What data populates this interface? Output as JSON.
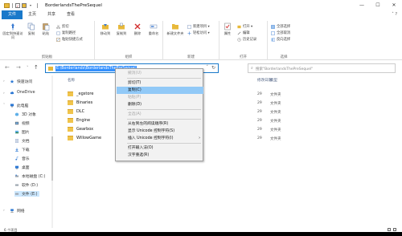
{
  "window": {
    "title": "BorderlandsThePreSequel",
    "controls": [
      "—",
      "☐",
      "✕"
    ]
  },
  "ribbon_tabs": [
    "文件",
    "主页",
    "共享",
    "查看"
  ],
  "ribbon": {
    "clipboard": {
      "label": "剪贴板",
      "pin": "固定到快速访问",
      "copy": "复制",
      "paste": "粘贴",
      "cut": "剪切",
      "copy_path": "复制路径",
      "paste_shortcut": "粘贴快捷方式"
    },
    "organize": {
      "label": "组织",
      "move_to": "移动到",
      "copy_to": "复制到",
      "delete": "删除",
      "rename": "重命名"
    },
    "new": {
      "label": "新建",
      "new_folder": "新建文件夹",
      "new_item": "新建项目 ▾",
      "easy_access": "轻松访问 ▾"
    },
    "open": {
      "label": "打开",
      "properties": "属性",
      "open": "打开 ▾",
      "edit": "编辑",
      "history": "历史记录"
    },
    "select": {
      "label": "选择",
      "select_all": "全部选择",
      "select_none": "全部取消",
      "invert": "反向选择"
    }
  },
  "address": {
    "path": "E:\\Borderlands\\BorderlandsThePreSequel",
    "search_placeholder": "搜索\"BorderlandsThePreSequel\""
  },
  "columns": {
    "name": "名称",
    "date": "修改日期",
    "type": "类型"
  },
  "nav_pane": [
    {
      "label": "快速访问",
      "icon": "star-icon"
    },
    {
      "label": "OneDrive",
      "icon": "cloud-icon"
    },
    {
      "label": "此电脑",
      "icon": "computer-icon"
    },
    {
      "label": "3D 对象",
      "icon": "cube-icon"
    },
    {
      "label": "视频",
      "icon": "video-icon"
    },
    {
      "label": "图片",
      "icon": "picture-icon"
    },
    {
      "label": "文档",
      "icon": "document-icon"
    },
    {
      "label": "下载",
      "icon": "download-icon"
    },
    {
      "label": "音乐",
      "icon": "music-icon"
    },
    {
      "label": "桌面",
      "icon": "desktop-icon"
    },
    {
      "label": "本地磁盘 (C:)",
      "icon": "drive-icon"
    },
    {
      "label": "软件 (D:)",
      "icon": "drive-icon"
    },
    {
      "label": "文件 (E:)",
      "icon": "drive-icon"
    },
    {
      "label": "网络",
      "icon": "network-icon"
    }
  ],
  "files": [
    {
      "name": "_egstore",
      "date": "29",
      "type": "文件夹"
    },
    {
      "name": "Binaries",
      "date": "29",
      "type": "文件夹"
    },
    {
      "name": "DLC",
      "date": "29",
      "type": "文件夹"
    },
    {
      "name": "Engine",
      "date": "29",
      "type": "文件夹"
    },
    {
      "name": "Gearbox",
      "date": "29",
      "type": "文件夹"
    },
    {
      "name": "WillowGame",
      "date": "29",
      "type": "文件夹"
    }
  ],
  "context_menu": {
    "items": [
      {
        "label": "撤消(U)",
        "disabled": true
      },
      {
        "label": "剪切(T)",
        "disabled": false
      },
      {
        "label": "复制(C)",
        "disabled": false,
        "highlighted": true
      },
      {
        "label": "粘贴(P)",
        "disabled": true
      },
      {
        "label": "删除(D)",
        "disabled": false
      },
      {
        "label": "全选(A)",
        "disabled": true
      },
      {
        "label": "从右到左的阅读顺序(R)",
        "disabled": false
      },
      {
        "label": "显示 Unicode 控制字符(S)",
        "disabled": false
      },
      {
        "label": "插入 Unicode 控制字符(I)",
        "disabled": false,
        "submenu": true
      },
      {
        "label": "打开输入法(O)",
        "disabled": false
      },
      {
        "label": "汉字重选(R)",
        "disabled": false
      }
    ]
  },
  "status": {
    "count": "6 个项目"
  },
  "colors": {
    "accent": "#1979ca",
    "folder": "#f0c44c",
    "highlight": "#91c9f7"
  }
}
